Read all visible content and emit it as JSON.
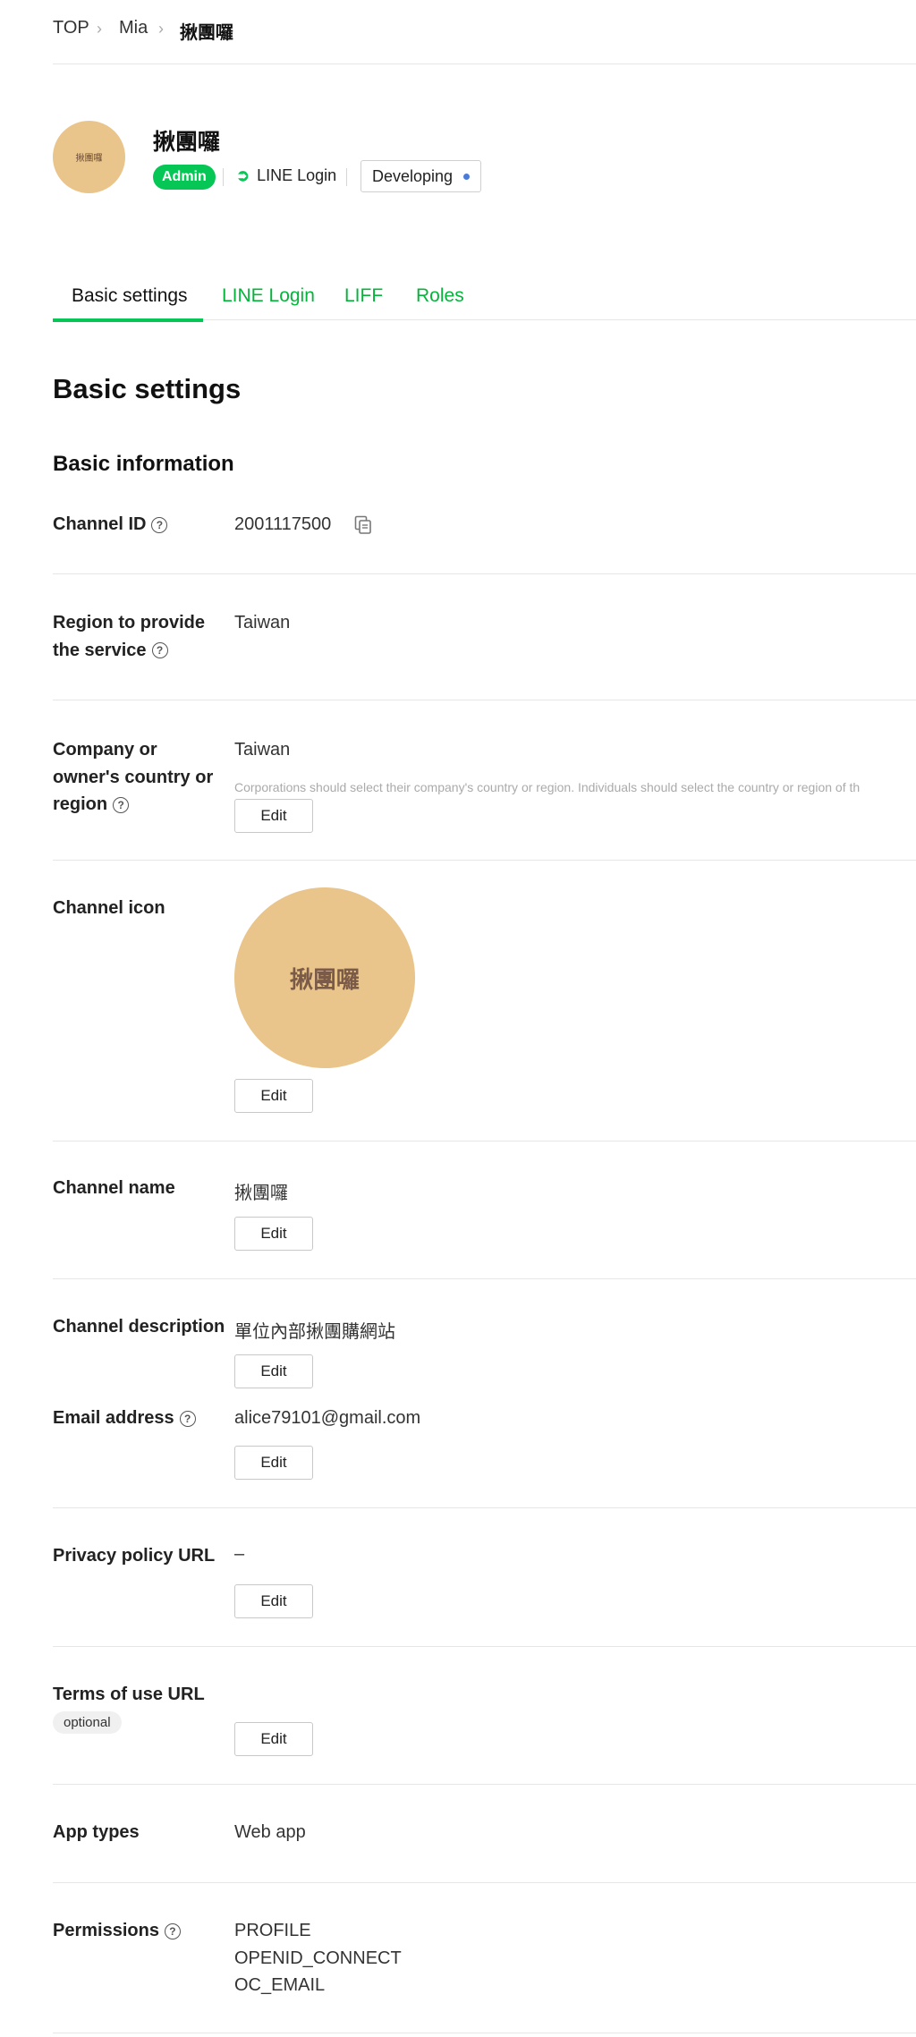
{
  "breadcrumb": {
    "top": "TOP",
    "provider": "Mia",
    "current": "揪團囉"
  },
  "header": {
    "avatar_text": "揪團囉",
    "title": "揪團囉",
    "role_badge": "Admin",
    "channel_type": "LINE Login",
    "status": "Developing",
    "colors": {
      "accent": "#06c755",
      "avatar": "#e9c48b",
      "status_dot": "#4a7bd8"
    }
  },
  "tabs": [
    {
      "label": "Basic settings",
      "active": true
    },
    {
      "label": "LINE Login",
      "active": false
    },
    {
      "label": "LIFF",
      "active": false
    },
    {
      "label": "Roles",
      "active": false
    }
  ],
  "page_title": "Basic settings",
  "section_title": "Basic information",
  "fields": {
    "channel_id": {
      "label": "Channel ID",
      "value": "2001117500"
    },
    "region": {
      "label_line1": "Region to provide",
      "label_line2": "the service",
      "value": "Taiwan"
    },
    "company_country": {
      "label_line1": "Company or",
      "label_line2": "owner's country or",
      "label_line3": "region",
      "value": "Taiwan",
      "note": "Corporations should select their company's country or region. Individuals should select the country or region of th",
      "edit": "Edit"
    },
    "channel_icon": {
      "label": "Channel icon",
      "icon_text": "揪團囉",
      "edit": "Edit"
    },
    "channel_name": {
      "label": "Channel name",
      "value": "揪團囉",
      "edit": "Edit"
    },
    "channel_description": {
      "label": "Channel description",
      "value": "單位內部揪團購網站",
      "edit": "Edit"
    },
    "email": {
      "label": "Email address",
      "value": "alice79101@gmail.com",
      "edit": "Edit"
    },
    "privacy_policy": {
      "label": "Privacy policy URL",
      "value": "–",
      "edit": "Edit"
    },
    "terms_of_use": {
      "label": "Terms of use URL",
      "optional": "optional",
      "edit": "Edit"
    },
    "app_types": {
      "label": "App types",
      "value": "Web app"
    },
    "permissions": {
      "label": "Permissions",
      "values": [
        "PROFILE",
        "OPENID_CONNECT",
        "OC_EMAIL"
      ]
    }
  },
  "help_glyph": "?"
}
